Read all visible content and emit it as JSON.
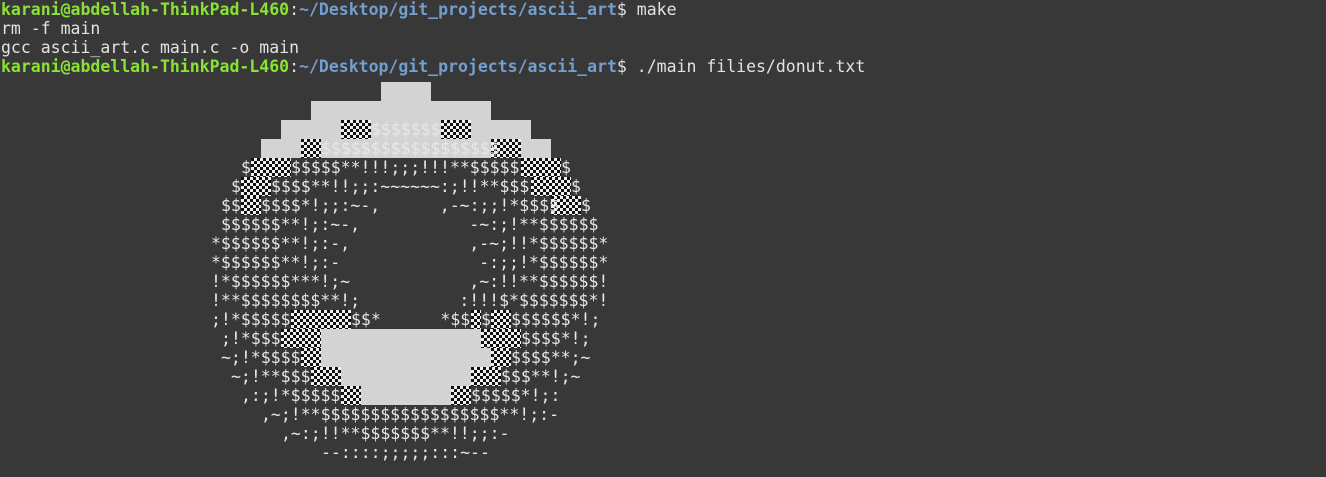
{
  "prompt": {
    "user_host": "karani@abdellah-ThinkPad-L460",
    "sep": ":",
    "path": "~/Desktop/git_projects/ascii_art",
    "symbol": "$ "
  },
  "commands": {
    "first": "make",
    "second": "./main filies/donut.txt"
  },
  "output": {
    "line1": "rm -f main",
    "line2": "gcc ascii_art.c main.c -o main"
  },
  "art": {
    "r03": "$$$$$$$",
    "r04": "$$$$$$$$$$$$$$$$$$",
    "r05a": "$",
    "r05b": "$$$$$**!!!;;;!!!**$$$$$",
    "r05c": "$",
    "r06a": "$",
    "r06b": "$$$$**!!;;:~~~~~~:;!!**$$$",
    "r06c": "$",
    "r07a": "$$",
    "r07b": "$$$$*!;;:~-,      ,-~:;;!*$$$$",
    "r07c": "$",
    "r08": "$$$$$$**!;:~-,           -~:;!**$$$$$$",
    "r09": "*$$$$$$**!;:-,            ,-~;!!*$$$$$$*",
    "r10": "*$$$$$$**!;:-              -:;;!*$$$$$$*",
    "r11": "!*$$$$$$***!;~            ,~:!!**$$$$$$!",
    "r12": "!**$$$$$$$$**!;          :!!!$*$$$$$$$*!",
    "r13a": ";!*$$$$$",
    "r13b": "$$*      *$$$",
    "r13c": "$",
    "r13d": "$$$$$$*!;",
    "r14a": ";!*$$$",
    "r14b": "$$$$*!;",
    "r15a": "~;!*$$$$",
    "r15b": "$$$$**;~",
    "r16a": "~;!**$$$",
    "r16b": "$$$**!;~",
    "r17a": ",:;!*$$$$$",
    "r17b": "$$$$$*!;:",
    "r18": ",~;!**$$$$$$$$$$$$$$$$$$**!;:-",
    "r19": ",~:;!!**$$$$$$$**!!;;:-",
    "r20": "--::::;;;;;:::~--"
  }
}
